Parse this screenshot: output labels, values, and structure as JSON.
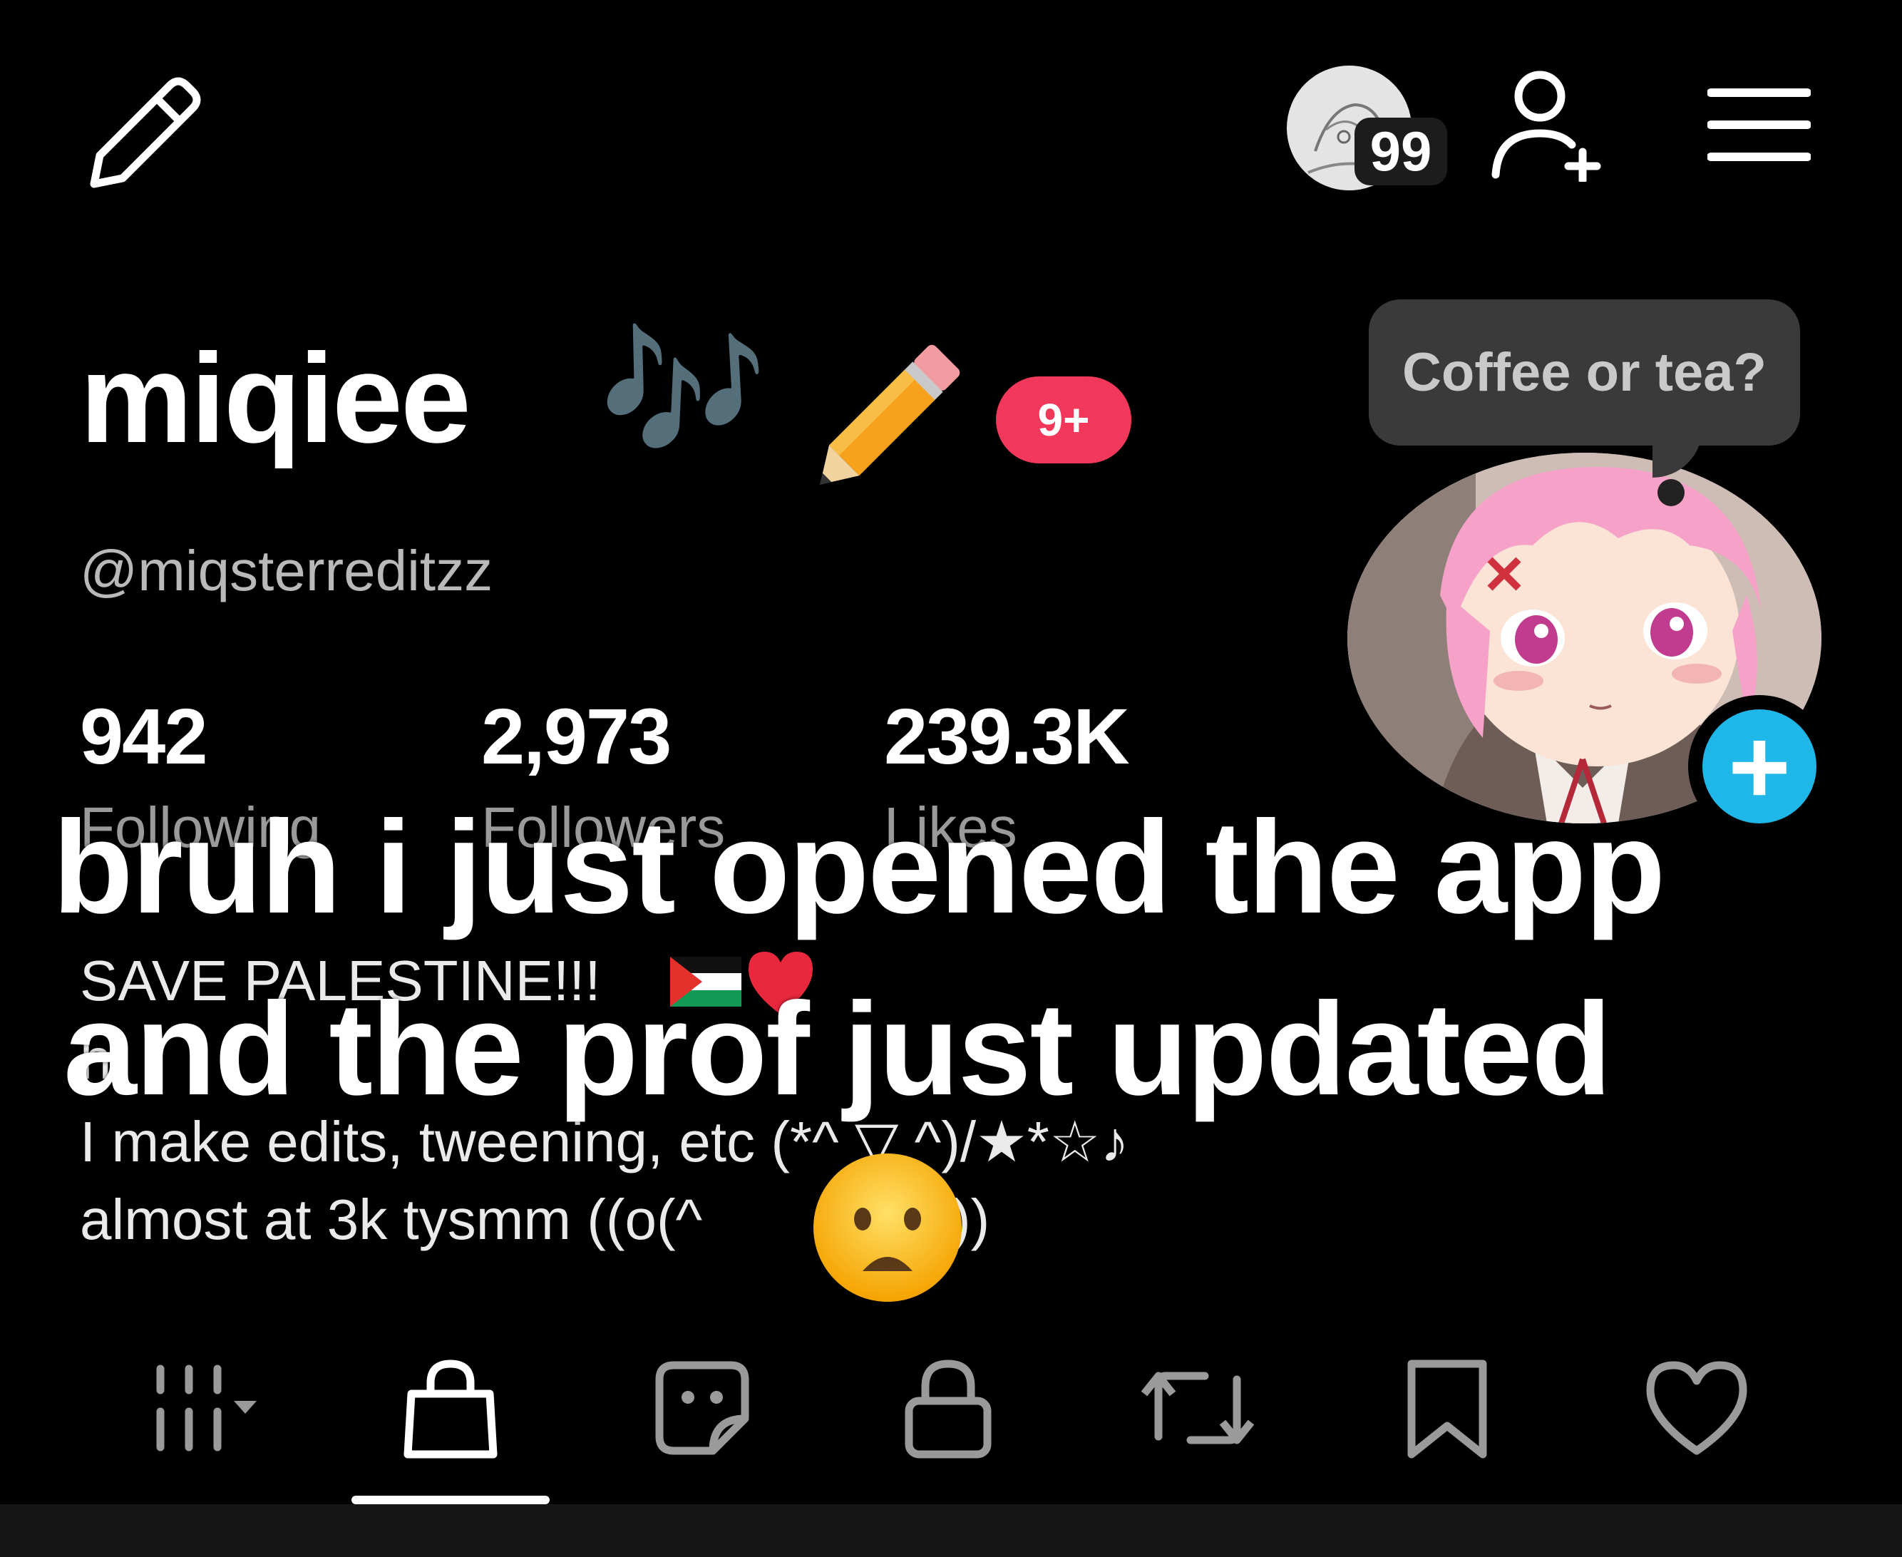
{
  "header": {
    "edit_icon": "pencil-icon",
    "visitor_count": "99",
    "add_friend_icon": "person-add-icon",
    "menu_icon": "hamburger-menu-icon"
  },
  "profile": {
    "display_name": "miqiee",
    "name_emoji": "🎶",
    "name_emoji2": "✏️",
    "notification_badge": "9+",
    "handle": "@miqsterreditzz",
    "status_tooltip": "Coffee or tea?"
  },
  "stats": [
    {
      "value": "942",
      "label": "Following"
    },
    {
      "value": "2,973",
      "label": "Followers"
    },
    {
      "value": "239.3K",
      "label": "Likes"
    }
  ],
  "bio": {
    "line1": "SAVE PALESTINE!!!",
    "line1_emoji": "🇵🇸❤️",
    "line2": "h",
    "line3": "I make edits, tweening, etc (*^ ▽ ^)/★*☆♪",
    "line4": "almost at 3k tysmm ((o(^",
    "line4_end": "))"
  },
  "caption": {
    "line1": "bruh i just opened the app",
    "line2": "and the prof just updated"
  },
  "overlay_emoji": "😦",
  "tabs": [
    {
      "name": "videos-grid",
      "icon": "grid-icon",
      "active": false
    },
    {
      "name": "shop",
      "icon": "shopping-bag-icon",
      "active": true
    },
    {
      "name": "stickers",
      "icon": "sticker-icon",
      "active": false
    },
    {
      "name": "private",
      "icon": "lock-icon",
      "active": false
    },
    {
      "name": "reposts",
      "icon": "repost-icon",
      "active": false
    },
    {
      "name": "favorites",
      "icon": "bookmark-icon",
      "active": false
    },
    {
      "name": "liked",
      "icon": "heart-icon",
      "active": false
    }
  ],
  "colors": {
    "background": "#000000",
    "badge_red": "#f2385a",
    "add_button_blue": "#1fb6e8",
    "tooltip_bg": "#3a3a3a"
  }
}
